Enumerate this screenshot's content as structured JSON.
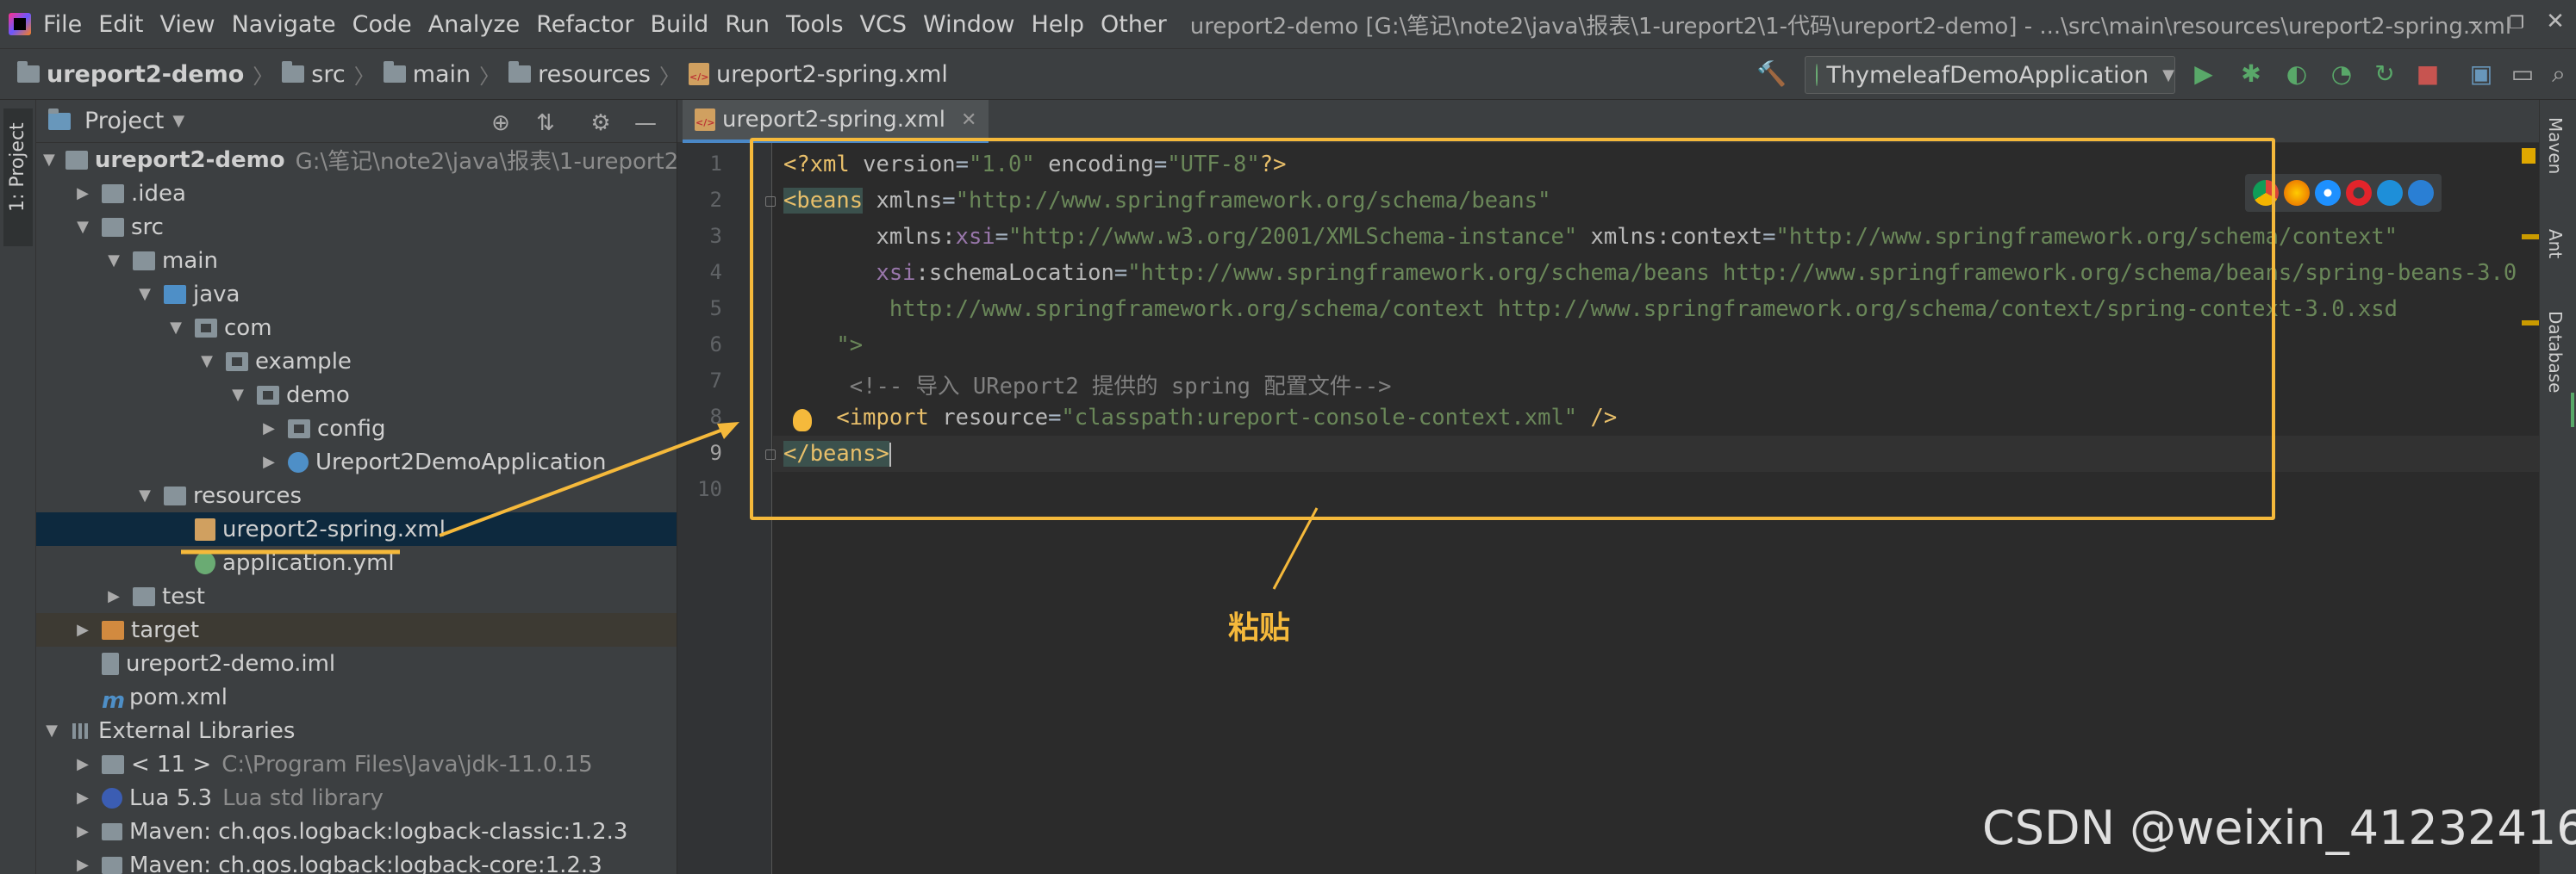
{
  "menubar": {
    "items": [
      "File",
      "Edit",
      "View",
      "Navigate",
      "Code",
      "Analyze",
      "Refactor",
      "Build",
      "Run",
      "Tools",
      "VCS",
      "Window",
      "Help",
      "Other"
    ],
    "window_title": "ureport2-demo [G:\\笔记\\note2\\java\\报表\\1-ureport2\\1-代码\\ureport2-demo] - ...\\src\\main\\resources\\ureport2-spring.xml",
    "controls": [
      "–",
      "❐",
      "✕"
    ]
  },
  "navbar": {
    "crumbs": [
      "ureport2-demo",
      "src",
      "main",
      "resources",
      "ureport2-spring.xml"
    ],
    "run_config": "ThymeleafDemoApplication"
  },
  "left_stripe": {
    "project_label": "1: Project"
  },
  "project_panel": {
    "title": "Project",
    "tree": [
      {
        "label": "ureport2-demo",
        "secondary": "G:\\笔记\\note2\\java\\报表\\1-ureport2\\1-",
        "icon": "folder-icon",
        "expanded": true
      },
      {
        "label": ".idea",
        "icon": "folder-icon",
        "expanded": false
      },
      {
        "label": "src",
        "icon": "folder-icon",
        "expanded": true
      },
      {
        "label": "main",
        "icon": "folder-icon",
        "expanded": true
      },
      {
        "label": "java",
        "icon": "source-folder-icon",
        "expanded": true
      },
      {
        "label": "com",
        "icon": "package-icon",
        "expanded": true
      },
      {
        "label": "example",
        "icon": "package-icon",
        "expanded": true
      },
      {
        "label": "demo",
        "icon": "package-icon",
        "expanded": true
      },
      {
        "label": "config",
        "icon": "package-icon",
        "expanded": false
      },
      {
        "label": "Ureport2DemoApplication",
        "icon": "spring-class-icon",
        "expanded": false
      },
      {
        "label": "resources",
        "icon": "resources-folder-icon",
        "expanded": true
      },
      {
        "label": "ureport2-spring.xml",
        "icon": "xml-file-icon"
      },
      {
        "label": "application.yml",
        "icon": "yml-file-icon"
      },
      {
        "label": "test",
        "icon": "folder-icon",
        "expanded": false
      },
      {
        "label": "target",
        "icon": "excluded-folder-icon",
        "expanded": false
      },
      {
        "label": "ureport2-demo.iml",
        "icon": "iml-file-icon"
      },
      {
        "label": "pom.xml",
        "icon": "maven-file-icon"
      },
      {
        "label": "External Libraries",
        "icon": "libraries-icon",
        "expanded": true
      },
      {
        "label": "< 11 >",
        "secondary": "C:\\Program Files\\Java\\jdk-11.0.15",
        "icon": "jdk-icon",
        "expanded": false
      },
      {
        "label": "Lua 5.3",
        "secondary": "Lua std library",
        "icon": "lua-icon",
        "expanded": false
      },
      {
        "label": "Maven: ch.qos.logback:logback-classic:1.2.3",
        "icon": "maven-lib-icon",
        "expanded": false
      },
      {
        "label": "Maven: ch.qos.logback:logback-core:1.2.3",
        "icon": "maven-lib-icon",
        "expanded": false
      }
    ]
  },
  "editor": {
    "tab_label": "ureport2-spring.xml",
    "line_numbers": [
      "1",
      "2",
      "3",
      "4",
      "5",
      "6",
      "7",
      "8",
      "9",
      "10"
    ],
    "code": {
      "l1_pi_open": "<?xml ",
      "l1_a1": "version",
      "l1_eq1": "=",
      "l1_v1": "\"1.0\"",
      "l1_a2": " encoding",
      "l1_eq2": "=",
      "l1_v2": "\"UTF-8\"",
      "l1_pi_close": "?>",
      "l2_tag": "<beans",
      "l2_a": " xmlns",
      "l2_eq": "=",
      "l2_v": "\"http://www.springframework.org/schema/beans\"",
      "l3_indent": "       ",
      "l3_a1": "xmlns:",
      "l3_ns1": "xsi",
      "l3_eq1": "=",
      "l3_v1": "\"http://www.w3.org/2001/XMLSchema-instance\"",
      "l3_a2": " xmlns:context",
      "l3_eq2": "=",
      "l3_v2": "\"http://www.springframework.org/schema/context\"",
      "l4_indent": "       ",
      "l4_ns": "xsi",
      "l4_a": ":schemaLocation",
      "l4_eq": "=",
      "l4_v": "\"http://www.springframework.org/schema/beans http://www.springframework.org/schema/beans/spring-beans-3.0",
      "l5": "        http://www.springframework.org/schema/context http://www.springframework.org/schema/context/spring-context-3.0.xsd",
      "l6": "    \">",
      "l7": "     <!-- 导入 UReport2 提供的 spring 配置文件-->",
      "l8_indent": "    ",
      "l8_tag": "<import",
      "l8_a": " resource",
      "l8_eq": "=",
      "l8_v": "\"classpath:ureport-console-context.xml\"",
      "l8_close": " />",
      "l9_tag": "</beans>"
    }
  },
  "right_stripe": {
    "labels": [
      "Maven",
      "Ant",
      "Database"
    ]
  },
  "annotation": {
    "paste_label": "粘贴"
  },
  "watermark": "CSDN @weixin_41232416",
  "colors": {
    "highlight": "#f5b93b",
    "selection": "#0d293e",
    "accent": "#4a88c7"
  }
}
